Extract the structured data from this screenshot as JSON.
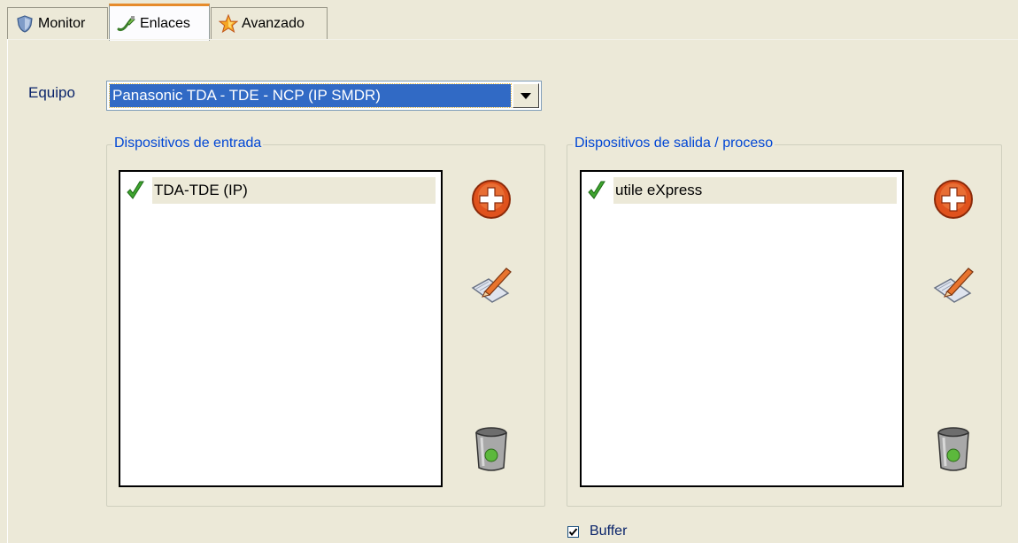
{
  "tabs": [
    {
      "label": "Monitor",
      "icon": "monitor-shield-icon",
      "active": false
    },
    {
      "label": "Enlaces",
      "icon": "link-cable-icon",
      "active": true
    },
    {
      "label": "Avanzado",
      "icon": "star-icon",
      "active": false
    }
  ],
  "equipo": {
    "label": "Equipo",
    "selected": "Panasonic TDA - TDE - NCP (IP SMDR)"
  },
  "input_group": {
    "title": "Dispositivos de entrada",
    "items": [
      {
        "label": "TDA-TDE (IP)",
        "status": "enabled"
      }
    ]
  },
  "output_group": {
    "title": "Dispositivos de salida / proceso",
    "items": [
      {
        "label": "utile eXpress",
        "status": "enabled"
      }
    ]
  },
  "buffer": {
    "label": "Buffer",
    "checked": true
  },
  "colors": {
    "background": "#ece9d8",
    "selection": "#316ac5",
    "group_title": "#0046d5",
    "accent_tab": "#e68b2c"
  }
}
